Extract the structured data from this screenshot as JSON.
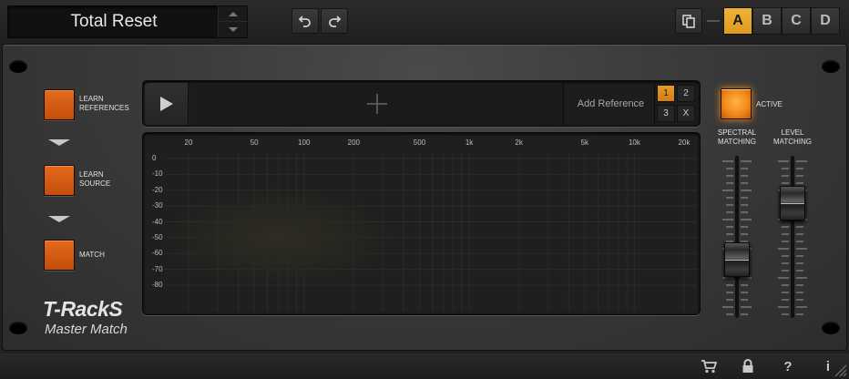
{
  "header": {
    "preset_name": "Total Reset",
    "slots": [
      {
        "label": "A",
        "active": true
      },
      {
        "label": "B",
        "active": false
      },
      {
        "label": "C",
        "active": false
      },
      {
        "label": "D",
        "active": false
      }
    ]
  },
  "left_controls": {
    "learn_references_label": "LEARN REFERENCES",
    "learn_source_label": "LEARN SOURCE",
    "match_label": "MATCH"
  },
  "logo": {
    "brand": "T-RackS",
    "product": "Master Match"
  },
  "reference_bar": {
    "add_reference_label": "Add Reference",
    "reference_slots": [
      "1",
      "2",
      "3",
      "X"
    ],
    "active_slot": "1"
  },
  "spectrum": {
    "x_ticks": [
      "20",
      "50",
      "100",
      "200",
      "500",
      "1k",
      "2k",
      "5k",
      "10k",
      "20k"
    ],
    "y_ticks": [
      "0",
      "-10",
      "-20",
      "-30",
      "-40",
      "-50",
      "-60",
      "-70",
      "-80"
    ]
  },
  "right_controls": {
    "active_label": "ACTIVE",
    "spectral_label": "SPECTRAL MATCHING",
    "level_label": "LEVEL MATCHING",
    "spectral_level": 0.3,
    "level_level": 0.78
  },
  "colors": {
    "accent_orange": "#e26417",
    "slot_active": "#f0b43a"
  },
  "footer": {
    "icons": [
      "cart-icon",
      "lock-icon",
      "help-icon",
      "info-icon"
    ]
  }
}
